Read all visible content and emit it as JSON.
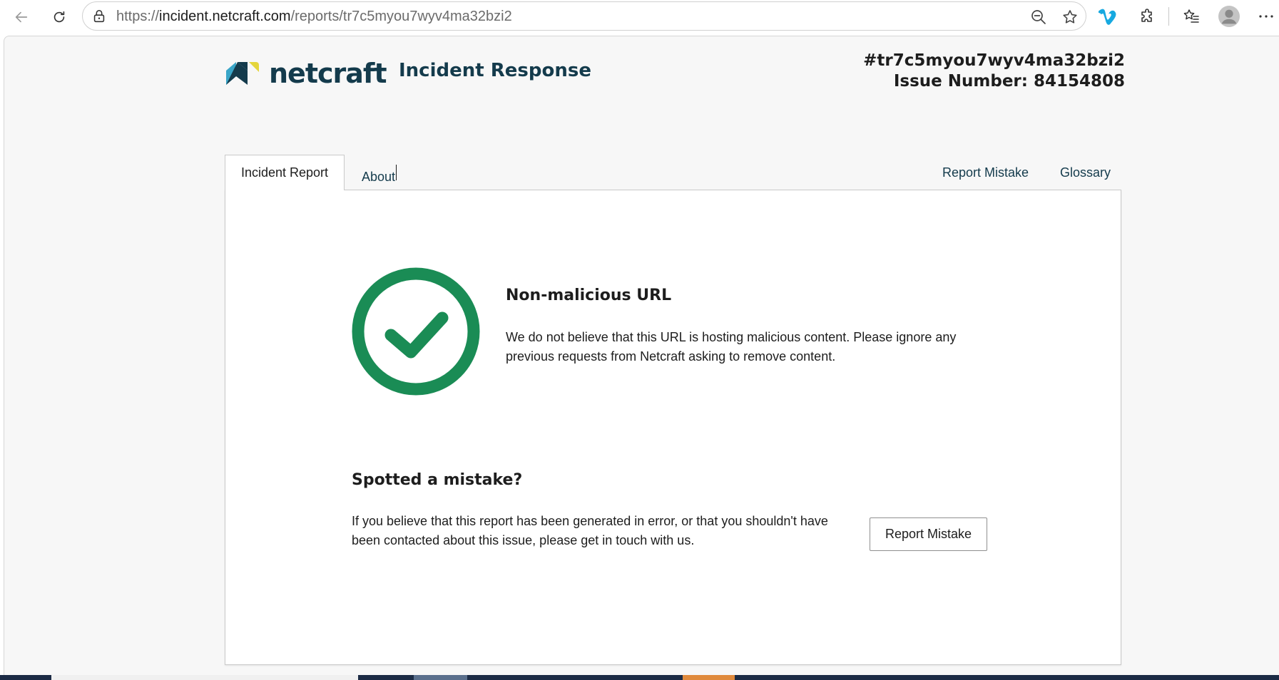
{
  "browser": {
    "url_prefix": "https://",
    "url_host": "incident.netcraft.com",
    "url_path": "/reports/tr7c5myou7wyv4ma32bzi2",
    "icons": [
      "back-arrow-icon",
      "refresh-icon",
      "lock-icon",
      "zoom-out-icon",
      "star-icon",
      "vimeo-icon",
      "extensions-icon",
      "favorites-icon",
      "profile-icon",
      "more-icon"
    ]
  },
  "header": {
    "logo_text": "netcraft",
    "product_name": "Incident Response",
    "report_id": "#tr7c5myou7wyv4ma32bzi2",
    "issue_number": "Issue Number: 84154808"
  },
  "tabs": [
    {
      "label": "Incident Report",
      "active": true
    },
    {
      "label": "About",
      "active": false
    }
  ],
  "right_links": [
    {
      "label": "Report Mistake"
    },
    {
      "label": "Glossary"
    }
  ],
  "verdict": {
    "title": "Non-malicious URL",
    "text": "We do not believe that this URL is hosting malicious content. Please ignore any previous requests from Netcraft asking to remove content.",
    "icon": "check-circle-icon"
  },
  "mistake": {
    "title": "Spotted a mistake?",
    "text": "If you believe that this report has been generated in error, or that you shouldn't have been contacted about this issue, please get in touch with us.",
    "button_label": "Report Mistake"
  },
  "colors": {
    "brand_dark": "#143b4c",
    "success_green": "#1a8c55",
    "logo_blue": "#3aa6c8",
    "logo_yellow": "#e4d53c"
  }
}
